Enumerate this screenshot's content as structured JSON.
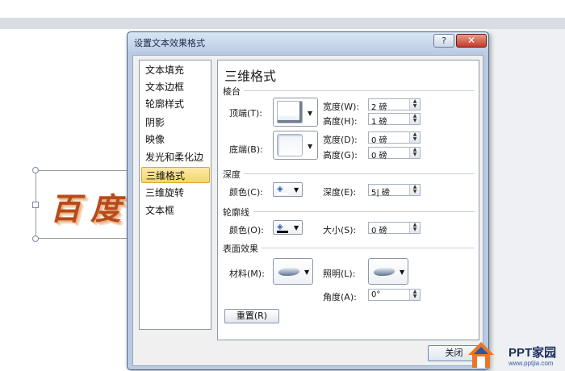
{
  "dialog": {
    "title": "设置文本效果格式",
    "help_label": "?",
    "close_label": "✕"
  },
  "categories": [
    {
      "label": "文本填充"
    },
    {
      "label": "文本边框"
    },
    {
      "label": "轮廓样式"
    },
    {
      "label": "阴影"
    },
    {
      "label": "映像"
    },
    {
      "label": "发光和柔化边缘"
    },
    {
      "label": "三维格式"
    },
    {
      "label": "三维旋转"
    },
    {
      "label": "文本框"
    }
  ],
  "selected_category": "三维格式",
  "panel": {
    "title": "三维格式",
    "bevel": {
      "section_label": "棱台",
      "top_label": "顶端(T):",
      "bottom_label": "底端(B):",
      "top_width_label": "宽度(W):",
      "top_width_value": "2 磅",
      "top_height_label": "高度(H):",
      "top_height_value": "1 磅",
      "bottom_width_label": "宽度(D):",
      "bottom_width_value": "0 磅",
      "bottom_height_label": "高度(G):",
      "bottom_height_value": "0 磅"
    },
    "depth": {
      "section_label": "深度",
      "color_label": "颜色(C):",
      "depth_label": "深度(E):",
      "depth_value": "5| 磅"
    },
    "contour": {
      "section_label": "轮廓线",
      "color_label": "颜色(O):",
      "size_label": "大小(S):",
      "size_value": "0 磅"
    },
    "surface": {
      "section_label": "表面效果",
      "material_label": "材料(M):",
      "lighting_label": "照明(L):",
      "angle_label": "角度(A):",
      "angle_value": "0°"
    },
    "reset_label": "重置(R)"
  },
  "close_button_label": "关闭",
  "slide": {
    "art_text": "百度"
  },
  "logo": {
    "title": "PPT家园",
    "url": "www.pptjia.com"
  }
}
